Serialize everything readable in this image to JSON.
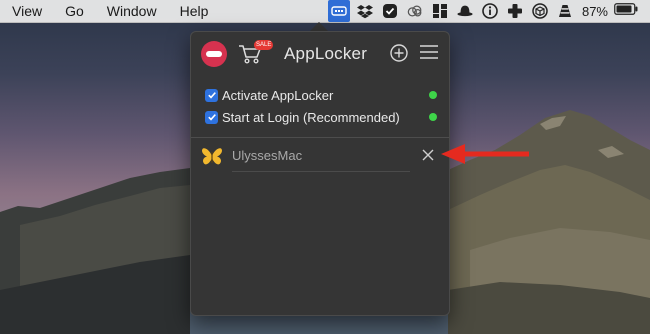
{
  "menubar": {
    "menus": [
      "View",
      "Go",
      "Window",
      "Help"
    ],
    "battery_percent": "87%",
    "tray_icons": [
      "applocker-icon",
      "dropbox-icon",
      "checkmark-circle-icon",
      "creative-cloud-icon",
      "grid-icon",
      "hat-icon",
      "info-icon",
      "plus-icon",
      "cube-icon",
      "vlc-icon",
      "battery-icon"
    ]
  },
  "popover": {
    "title": "AppLocker",
    "cart_badge": "SALE",
    "settings": [
      {
        "label": "Activate AppLocker",
        "checked": true,
        "status": "on"
      },
      {
        "label": "Start at Login (Recommended)",
        "checked": true,
        "status": "on"
      }
    ],
    "locked_apps": [
      {
        "name": "UlyssesMac",
        "icon": "butterfly-icon"
      }
    ]
  },
  "colors": {
    "accent": "#2e72df",
    "status_on": "#3ed449",
    "logo": "#d6324f",
    "arrow": "#e52a1f",
    "popover_bg": "#353535"
  }
}
